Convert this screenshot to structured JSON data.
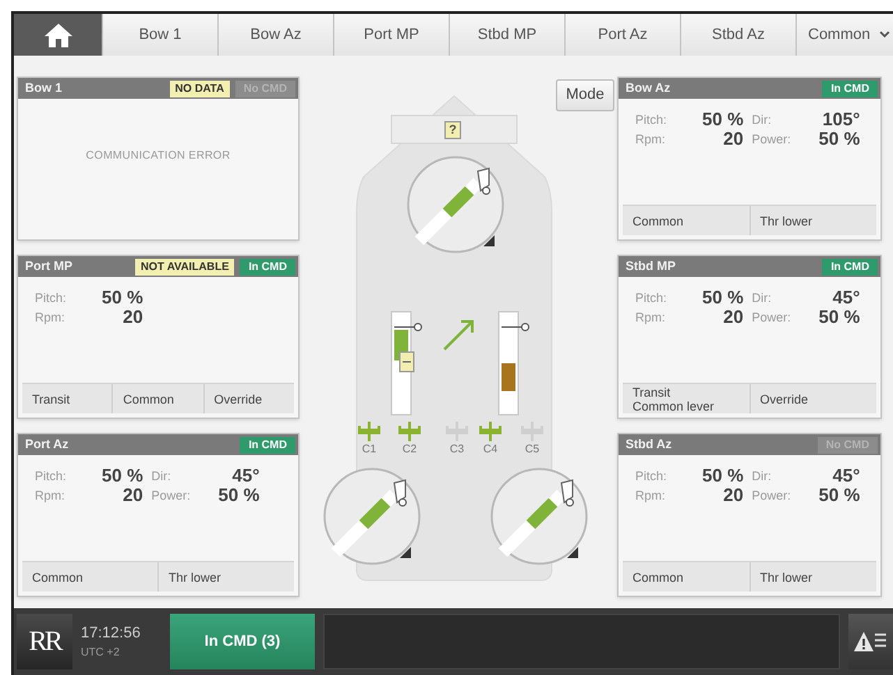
{
  "tabs": [
    {
      "kind": "home",
      "selected": true
    },
    {
      "kind": "tab",
      "label": "Bow 1",
      "selected": false
    },
    {
      "kind": "tab",
      "label": "Bow Az",
      "selected": false
    },
    {
      "kind": "tab",
      "label": "Port MP",
      "selected": false
    },
    {
      "kind": "tab",
      "label": "Stbd MP",
      "selected": false
    },
    {
      "kind": "tab",
      "label": "Port Az",
      "selected": false
    },
    {
      "kind": "tab",
      "label": "Stbd Az",
      "selected": false
    },
    {
      "kind": "dropdown",
      "label": "Common",
      "selected": false
    }
  ],
  "left_panels": [
    {
      "title": "Bow 1",
      "warning": "NO DATA",
      "cmd": {
        "label": "No CMD",
        "active": false
      },
      "error": "COMMUNICATION ERROR"
    },
    {
      "title": "Port MP",
      "warning": "NOT AVAILABLE",
      "cmd": {
        "label": "In CMD",
        "active": true
      },
      "readings": [
        [
          {
            "label": "Pitch:",
            "value": "50 %"
          },
          {
            "label": "Rpm:",
            "value": "20"
          }
        ]
      ],
      "footer": [
        [
          "Transit"
        ],
        [
          "Common"
        ],
        [
          "Override"
        ]
      ]
    },
    {
      "title": "Port Az",
      "cmd": {
        "label": "In CMD",
        "active": true
      },
      "readings": [
        [
          {
            "label": "Pitch:",
            "value": "50 %"
          },
          {
            "label": "Rpm:",
            "value": "20"
          }
        ],
        [
          {
            "label": "Dir:",
            "value": "45°"
          },
          {
            "label": "Power:",
            "value": "50 %"
          }
        ]
      ],
      "footer": [
        [
          "Common"
        ],
        [
          "Thr lower"
        ]
      ]
    }
  ],
  "center": {
    "mode_button": "Mode",
    "bow_badge": "?",
    "clutches": [
      {
        "label": "C1",
        "engaged": true
      },
      {
        "label": "C2",
        "engaged": true
      },
      {
        "label": "C3",
        "engaged": false
      },
      {
        "label": "C4",
        "engaged": true
      },
      {
        "label": "C5",
        "engaged": false
      }
    ]
  },
  "right_panels": [
    {
      "title": "Bow Az",
      "cmd": {
        "label": "In CMD",
        "active": true
      },
      "readings": [
        [
          {
            "label": "Pitch:",
            "value": "50 %"
          },
          {
            "label": "Rpm:",
            "value": "20"
          }
        ],
        [
          {
            "label": "Dir:",
            "value": "105°"
          },
          {
            "label": "Power:",
            "value": "50 %"
          }
        ]
      ],
      "footer": [
        [
          "Common"
        ],
        [
          "Thr lower"
        ]
      ]
    },
    {
      "title": "Stbd MP",
      "cmd": {
        "label": "In CMD",
        "active": true
      },
      "readings": [
        [
          {
            "label": "Pitch:",
            "value": "50 %"
          },
          {
            "label": "Rpm:",
            "value": "20"
          }
        ],
        [
          {
            "label": "Dir:",
            "value": "45°"
          },
          {
            "label": "Power:",
            "value": "50 %"
          }
        ]
      ],
      "footer": [
        [
          "Transit",
          "Common lever"
        ],
        [
          "Override"
        ]
      ]
    },
    {
      "title": "Stbd Az",
      "cmd": {
        "label": "No CMD",
        "active": false
      },
      "readings": [
        [
          {
            "label": "Pitch:",
            "value": "50 %"
          },
          {
            "label": "Rpm:",
            "value": "20"
          }
        ],
        [
          {
            "label": "Dir:",
            "value": "45°"
          },
          {
            "label": "Power:",
            "value": "50 %"
          }
        ]
      ],
      "footer": [
        [
          "Common"
        ],
        [
          "Thr lower"
        ]
      ]
    }
  ],
  "status_bar": {
    "logo": "RR",
    "time": "17:12:56",
    "timezone": "UTC +2",
    "cmd_button": "In CMD (3)"
  }
}
